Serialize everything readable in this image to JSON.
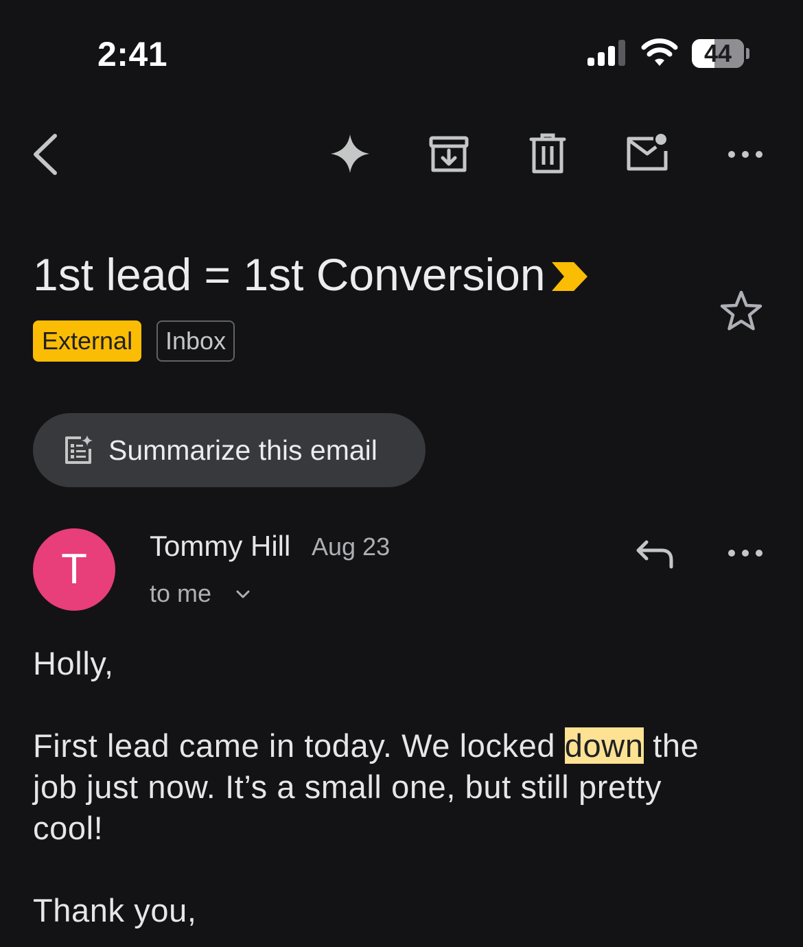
{
  "status_bar": {
    "time": "2:41",
    "battery_level": "44",
    "battery_fraction": 0.44
  },
  "toolbar": {
    "back_icon": "chevron-left-icon",
    "gemini_icon": "sparkle-icon",
    "archive_icon": "archive-icon",
    "delete_icon": "trash-icon",
    "unread_icon": "mark-unread-icon",
    "more_icon": "more-horizontal-icon"
  },
  "email": {
    "subject": "1st lead = 1st Conversion",
    "labels": [
      "External",
      "Inbox"
    ],
    "summarize_label": "Summarize this email",
    "sender_name": "Tommy Hill",
    "sender_initial": "T",
    "date": "Aug 23",
    "recipient": "to me",
    "body": {
      "greeting": "Holly,",
      "line1_before": "First lead came in today. We locked ",
      "highlight": "down",
      "line1_after": " the",
      "line2": "job just now. It’s a small one, but still pretty",
      "line3": "cool!",
      "closing": "Thank you,"
    }
  },
  "colors": {
    "background": "#131316",
    "external_chip": "#fbbc04",
    "avatar": "#e83e79",
    "highlight": "#fde293",
    "importance": "#fbbc04"
  }
}
